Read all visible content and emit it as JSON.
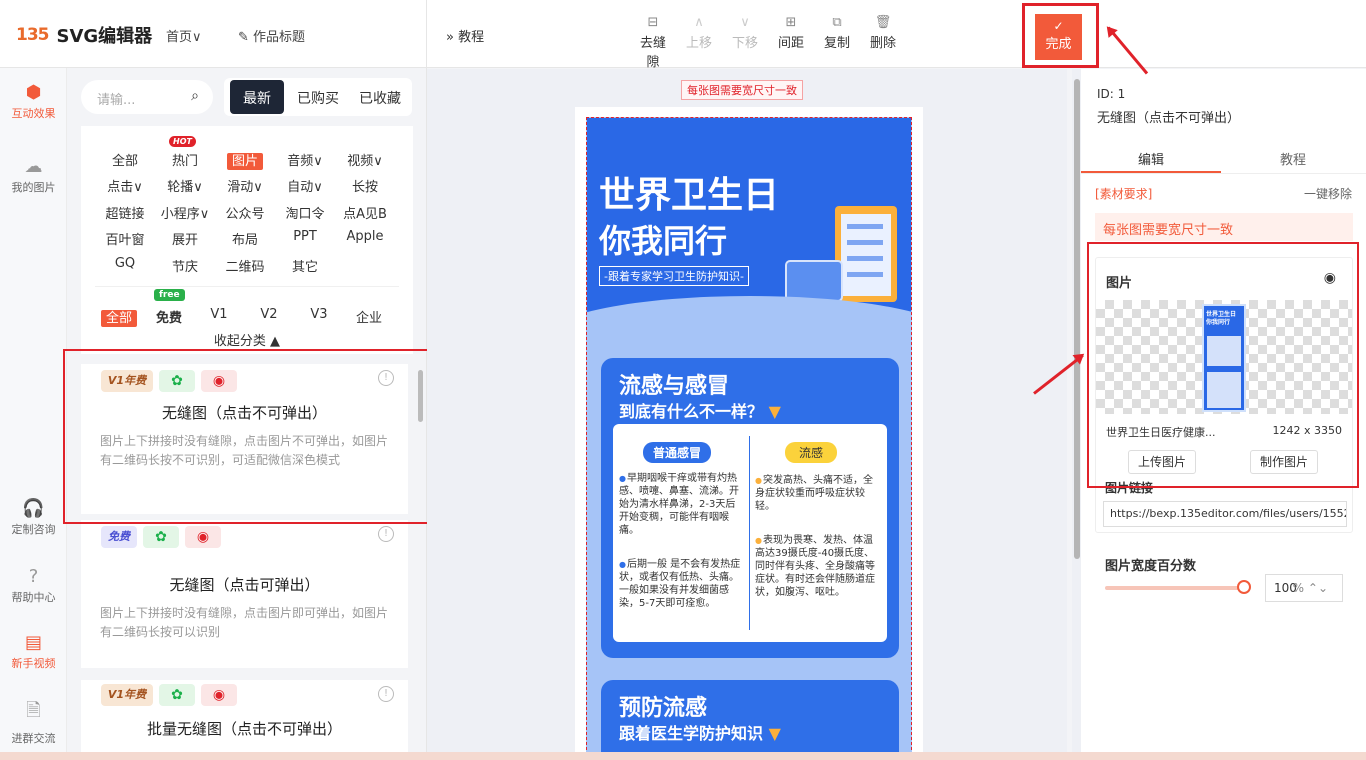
{
  "app": {
    "logo_mark": "135",
    "logo_text": "SVG编辑器",
    "home": "首页∨",
    "title_edit": "✎ 作品标题"
  },
  "toolbar": {
    "tutorial": "» 教程",
    "tools": [
      {
        "icon": "⊟",
        "label": "去缝隙",
        "disabled": false
      },
      {
        "icon": "∧",
        "label": "上移",
        "disabled": true
      },
      {
        "icon": "∨",
        "label": "下移",
        "disabled": true
      },
      {
        "icon": "⊞",
        "label": "间距",
        "disabled": false
      },
      {
        "icon": "⧉",
        "label": "复制",
        "disabled": false
      },
      {
        "icon": "🗑",
        "label": "删除",
        "disabled": false
      }
    ],
    "done_icon": "✓",
    "done_label": "完成"
  },
  "leftnav": [
    {
      "icon": "⬢",
      "label": "互动效果",
      "active": true
    },
    {
      "icon": "☁",
      "label": "我的图片"
    },
    {
      "icon": "🎧",
      "label": "定制咨询"
    },
    {
      "icon": "?",
      "label": "帮助中心"
    },
    {
      "icon": "▤",
      "label": "新手视频",
      "orange": true
    },
    {
      "icon": "🗎",
      "label": "进群交流"
    }
  ],
  "panel": {
    "search_placeholder": "请输...",
    "tabs": [
      "最新",
      "已购买",
      "已收藏"
    ],
    "hot_badge": "HOT",
    "free_badge": "free",
    "categories_row1": [
      [
        "全部",
        "热门",
        "图片",
        "音频∨",
        "视频∨"
      ],
      [
        "点击∨",
        "轮播∨",
        "滑动∨",
        "自动∨",
        "长按"
      ],
      [
        "超链接",
        "小程序∨",
        "公众号",
        "淘口令",
        "点A见B"
      ],
      [
        "百叶窗",
        "展开",
        "布局",
        "PPT",
        "Apple"
      ],
      [
        "GQ",
        "节庆",
        "二维码",
        "其它"
      ]
    ],
    "categories_row2": [
      "全部",
      "免费",
      "V1",
      "V2",
      "V3",
      "企业"
    ],
    "collapse": "收起分类 ▲",
    "cards": [
      {
        "badge": "V1年费",
        "title": "无缝图（点击不可弹出）",
        "desc": "图片上下拼接时没有缝隙，点击图片不可弹出，如图片有二维码长按不可识别，可适配微信深色模式"
      },
      {
        "badge": "免费",
        "title": "无缝图（点击可弹出）",
        "desc": "图片上下拼接时没有缝隙，点击图片即可弹出，如图片有二维码长按可以识别"
      },
      {
        "badge": "V1年费",
        "title": "批量无缝图（点击不可弹出）",
        "desc": ""
      }
    ],
    "wx_icon": "✿",
    "wb_icon": "◉",
    "info_icon": "!"
  },
  "canvas": {
    "hint": "每张图需要宽尺寸一致",
    "poster": {
      "title1": "世界卫生日",
      "title2": "你我同行",
      "subtitle": "-跟着专家学习卫生防护知识-",
      "sec1_t1": "流感与感冒",
      "sec1_t2": "到底有什么不一样？",
      "pill_a": "普通感冒",
      "pill_b": "流感",
      "a1": "早期咽喉干痒或带有灼热感、喷嚏、鼻塞、流涕。开始为清水样鼻涕，2-3天后开始变稠，可能伴有咽喉痛。",
      "a2": "后期一般 是不会有发热症状，或者仅有低热、头痛。一般如果没有并发细菌感染，5-7天即可痊愈。",
      "b1": "突发高热、头痛不适，全身症状较重而呼吸症状较轻。",
      "b2": "表现为畏寒、发热、体温高达39摄氏度-40摄氏度、同时伴有头疼、全身酸痛等症状。有时还会伴随肠道症状，如腹泻、呕吐。",
      "sec2_t1": "预防流感",
      "sec2_t2": "跟着医生学防护知识",
      "tri": "▼"
    }
  },
  "right": {
    "id": "ID: 1",
    "name": "无缝图（点击不可弹出）",
    "tabs": [
      "编辑",
      "教程"
    ],
    "req": "[素材要求]",
    "remove": "一键移除",
    "warn": "每张图需要宽尺寸一致",
    "img_title": "图片",
    "eye_icon": "◉",
    "thumb_t1": "世界卫生日",
    "thumb_t2": "你我同行",
    "file_name": "世界卫生日医疗健康...",
    "file_size": "1242 x 3350",
    "upload": "上传图片",
    "make": "制作图片",
    "link_label": "图片链接",
    "link_value": "https://bexp.135editor.com/files/users/1552/15",
    "pct_label": "图片宽度百分数",
    "pct_value": "100",
    "pct_unit": "% ⌃⌄",
    "slider_value": 1.0
  }
}
